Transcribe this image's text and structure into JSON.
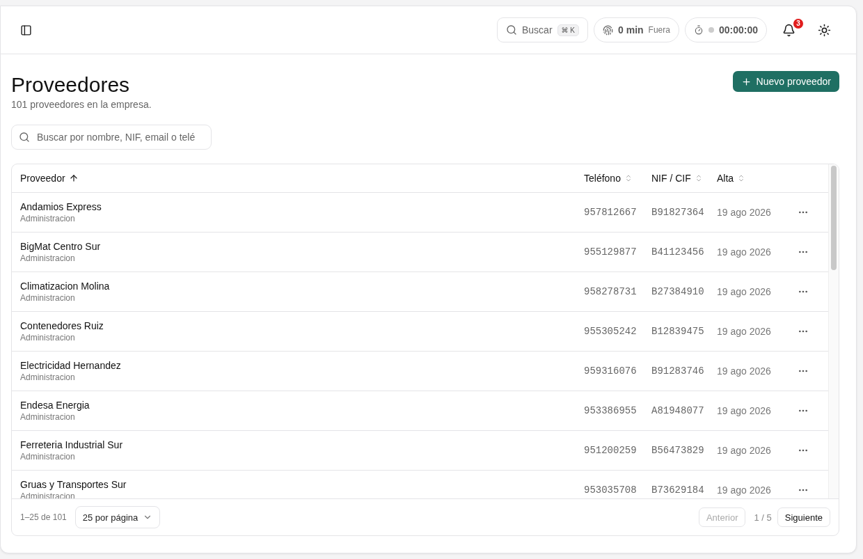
{
  "topbar": {
    "search": {
      "label": "Buscar",
      "shortcut": "⌘ K"
    },
    "presence": {
      "value": "0 min",
      "status": "Fuera"
    },
    "timer": {
      "value": "00:00:00",
      "running": false
    },
    "notifications": {
      "count": "3"
    }
  },
  "page": {
    "title": "Proveedores",
    "subtitle": "101 proveedores en la empresa.",
    "new_button": "Nuevo proveedor",
    "search_placeholder": "Buscar por nombre, NIF, email o telé"
  },
  "table": {
    "columns": [
      {
        "label": "Proveedor",
        "sorted": true
      },
      {
        "label": "Teléfono",
        "sorted": false
      },
      {
        "label": "NIF / CIF",
        "sorted": false
      },
      {
        "label": "Alta",
        "sorted": false
      }
    ],
    "rows": [
      {
        "name": "Andamios Express",
        "category": "Administracion",
        "phone": "957812667",
        "nif": "B91827364",
        "date": "19 ago 2026"
      },
      {
        "name": "BigMat Centro Sur",
        "category": "Administracion",
        "phone": "955129877",
        "nif": "B41123456",
        "date": "19 ago 2026"
      },
      {
        "name": "Climatizacion Molina",
        "category": "Administracion",
        "phone": "958278731",
        "nif": "B27384910",
        "date": "19 ago 2026"
      },
      {
        "name": "Contenedores Ruiz",
        "category": "Administracion",
        "phone": "955305242",
        "nif": "B12839475",
        "date": "19 ago 2026"
      },
      {
        "name": "Electricidad Hernandez",
        "category": "Administracion",
        "phone": "959316076",
        "nif": "B91283746",
        "date": "19 ago 2026"
      },
      {
        "name": "Endesa Energia",
        "category": "Administracion",
        "phone": "953386955",
        "nif": "A81948077",
        "date": "19 ago 2026"
      },
      {
        "name": "Ferreteria Industrial Sur",
        "category": "Administracion",
        "phone": "951200259",
        "nif": "B56473829",
        "date": "19 ago 2026"
      },
      {
        "name": "Gruas y Transportes Sur",
        "category": "Administracion",
        "phone": "953035708",
        "nif": "B73629184",
        "date": "19 ago 2026"
      }
    ]
  },
  "pagination": {
    "range": "1–25 de 101",
    "page_size": "25 por página",
    "previous": {
      "label": "Anterior",
      "disabled": true
    },
    "page": "1 / 5",
    "next": {
      "label": "Siguiente",
      "disabled": false
    }
  }
}
